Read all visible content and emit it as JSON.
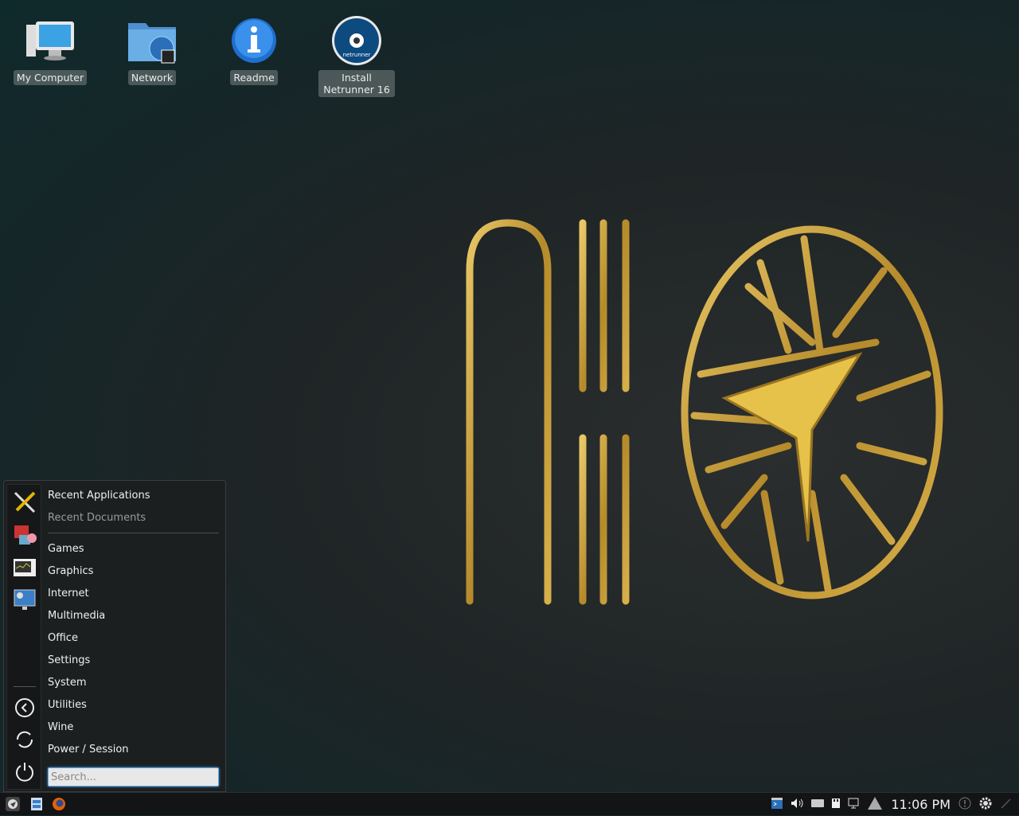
{
  "desktop": {
    "icons": [
      {
        "label": "My Computer",
        "icon": "computer-icon"
      },
      {
        "label": "Network",
        "icon": "network-folder-icon"
      },
      {
        "label": "Readme",
        "icon": "info-icon"
      },
      {
        "label": "Install Netrunner 16",
        "icon": "netrunner-disc-icon",
        "disc_text": "netrunner"
      }
    ]
  },
  "menu": {
    "items": [
      {
        "label": "Recent Applications",
        "dim": false
      },
      {
        "label": "Recent Documents",
        "dim": true
      },
      {
        "label": "Games"
      },
      {
        "label": "Graphics"
      },
      {
        "label": "Internet"
      },
      {
        "label": "Multimedia"
      },
      {
        "label": "Office"
      },
      {
        "label": "Settings"
      },
      {
        "label": "System"
      },
      {
        "label": "Utilities"
      },
      {
        "label": "Wine"
      },
      {
        "label": "Power / Session"
      }
    ],
    "search_placeholder": "Search..."
  },
  "taskbar": {
    "clock": "11:06 PM"
  },
  "colors": {
    "gold": "#c9a13b",
    "accent": "#5fa8e0"
  }
}
